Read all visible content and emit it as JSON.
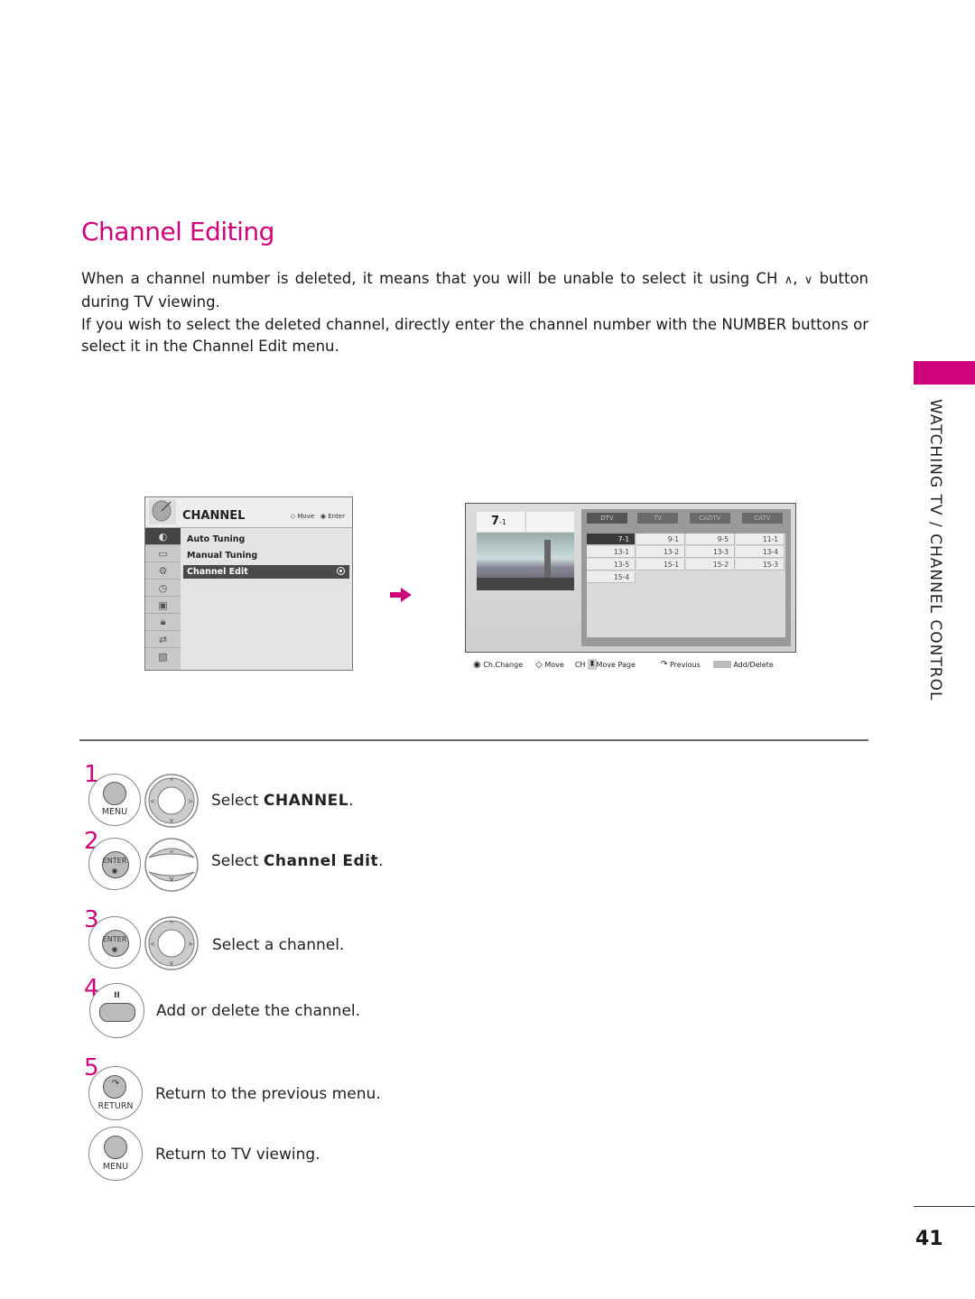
{
  "heading": "Channel Editing",
  "paragraphs": {
    "p1_a": "When a channel number is deleted, it means that you will be unable to select it using CH",
    "p1_up": "∧",
    "p1_sep": ",",
    "p1_down": "∨",
    "p1_b": "button during TV viewing.",
    "p2": "If you wish to select the deleted channel, directly enter the channel number with the NUMBER buttons or select it in the Channel Edit menu."
  },
  "section_label": "WATCHING TV / CHANNEL CONTROL",
  "page_number": "41",
  "accent_color": "#d0047a",
  "osd_menu": {
    "title": "CHANNEL",
    "hint_move": "Move",
    "hint_enter": "Enter",
    "sidebar_icons": [
      "channel-icon",
      "picture-icon",
      "audio-icon",
      "time-icon",
      "option-icon",
      "lock-icon",
      "input-icon",
      "usb-icon"
    ],
    "items": [
      {
        "label": "Auto Tuning",
        "selected": false
      },
      {
        "label": "Manual Tuning",
        "selected": false
      },
      {
        "label": "Channel Edit",
        "selected": true
      }
    ]
  },
  "channel_edit_screen": {
    "current_channel_major": "7",
    "current_channel_minor": "-1",
    "tabs": [
      "DTV",
      "TV",
      "CADTV",
      "CATV"
    ],
    "active_tab": "DTV",
    "channels": [
      "7-1",
      "9-1",
      "9-5",
      "11-1",
      "13-1",
      "13-2",
      "13-3",
      "13-4",
      "13-5",
      "15-1",
      "15-2",
      "15-3",
      "15-4"
    ],
    "selected_channel": "7-1",
    "legend": {
      "ch_change": "Ch.Change",
      "move": "Move",
      "ch": "CH",
      "move_page": "Move Page",
      "previous": "Previous",
      "add_delete": "Add/Delete"
    }
  },
  "steps": [
    {
      "number": "1",
      "buttons": [
        "MENU",
        "nav-4way"
      ],
      "text_pre": "Select ",
      "text_bold": "CHANNEL",
      "text_post": "."
    },
    {
      "number": "2",
      "buttons": [
        "ENTER",
        "nav-updown"
      ],
      "text_pre": "Select ",
      "text_bold": "Channel Edit",
      "text_post": "."
    },
    {
      "number": "3",
      "buttons": [
        "ENTER",
        "nav-4way"
      ],
      "text_pre": "Select a channel.",
      "text_bold": "",
      "text_post": ""
    },
    {
      "number": "4",
      "buttons": [
        "pause-yellow"
      ],
      "text_pre": "Add or delete the channel.",
      "text_bold": "",
      "text_post": ""
    },
    {
      "number": "5",
      "buttons": [
        "RETURN"
      ],
      "text_pre": "Return to the previous menu.",
      "text_bold": "",
      "text_post": ""
    },
    {
      "number": "",
      "buttons": [
        "MENU"
      ],
      "text_pre": "Return to TV viewing.",
      "text_bold": "",
      "text_post": ""
    }
  ],
  "button_labels": {
    "menu": "MENU",
    "enter": "ENTER",
    "return": "RETURN"
  }
}
